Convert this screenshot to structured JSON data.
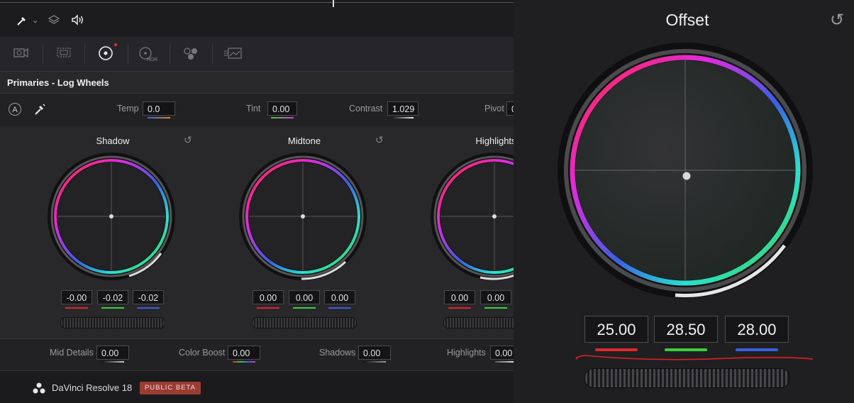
{
  "topbar": {
    "eyedropper_icon": "eyedropper-icon",
    "layers_icon": "layers-icon",
    "audio_icon": "speaker-icon"
  },
  "toolbar": {
    "tools": [
      "camera-raw-icon",
      "color-match-icon",
      "color-wheels-icon",
      "hdr-icon",
      "rgb-mixer-icon",
      "motion-effects-icon"
    ],
    "hdr_label": "HDR"
  },
  "panel": {
    "title": "Primaries - Log Wheels",
    "auto_label": "A"
  },
  "params_top": [
    {
      "label": "Temp",
      "value": "0.0"
    },
    {
      "label": "Tint",
      "value": "0.00"
    },
    {
      "label": "Contrast",
      "value": "1.029"
    },
    {
      "label": "Pivot",
      "value": "0"
    }
  ],
  "wheels": [
    {
      "name": "Shadow",
      "values": [
        "-0.00",
        "-0.02",
        "-0.02"
      ]
    },
    {
      "name": "Midtone",
      "values": [
        "0.00",
        "0.00",
        "0.00"
      ]
    },
    {
      "name": "Highlights",
      "values": [
        "0.00",
        "0.00"
      ]
    }
  ],
  "params_bottom": [
    {
      "label": "Mid Details",
      "value": "0.00"
    },
    {
      "label": "Color Boost",
      "value": "0.00"
    },
    {
      "label": "Shadows",
      "value": "0.00"
    },
    {
      "label": "Highlights",
      "value": "0.00"
    }
  ],
  "footer": {
    "app_name": "DaVinci Resolve 18",
    "badge": "PUBLIC BETA"
  },
  "offset": {
    "title": "Offset",
    "values": [
      "25.00",
      "28.50",
      "28.00"
    ]
  },
  "colors": {
    "red": "#e0262b",
    "green": "#3ccf3c",
    "blue": "#3b5fe0",
    "beta_bg": "#9b3c33",
    "annotation": "#e02020"
  }
}
